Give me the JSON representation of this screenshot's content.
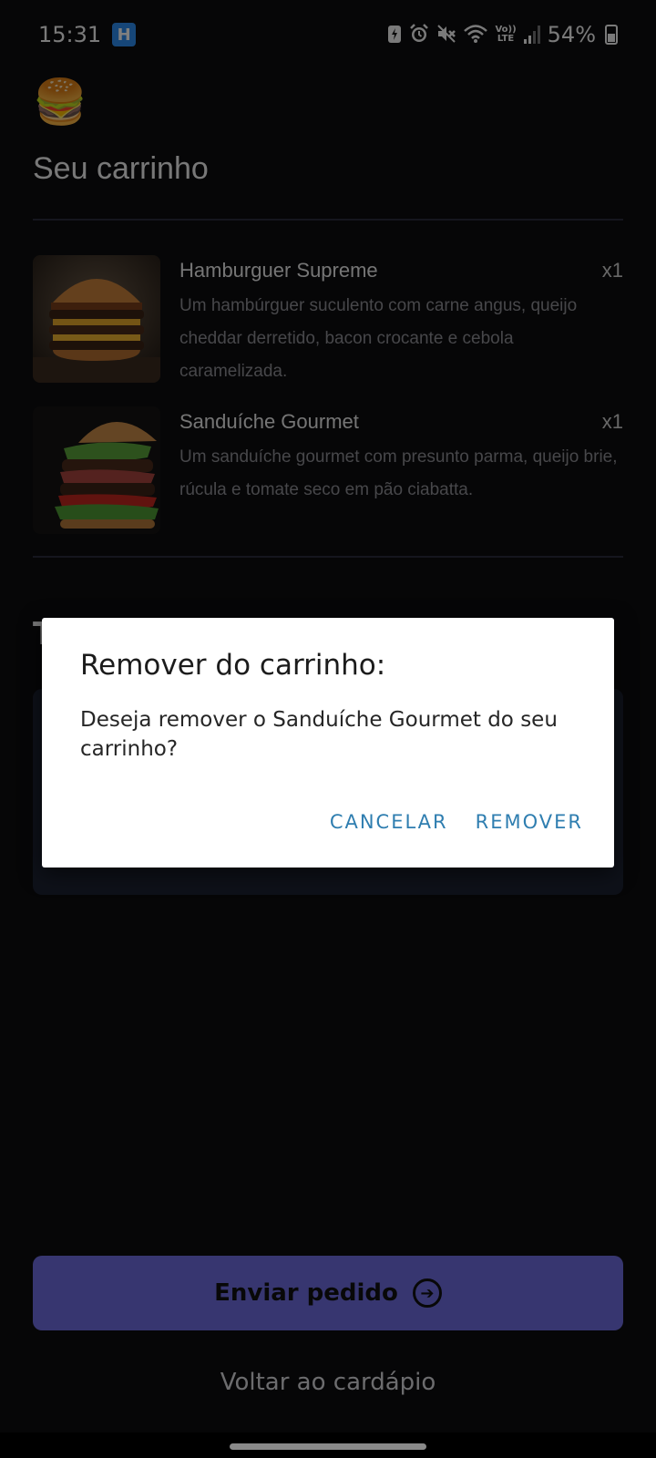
{
  "status_bar": {
    "time": "15:31",
    "app_badge_letter": "H",
    "battery_percent": "54%",
    "volte_top": "Vo))",
    "volte_bottom": "LTE",
    "icons": [
      "battery-saver-icon",
      "alarm-icon",
      "mute-icon",
      "wifi-icon",
      "volte-icon",
      "signal-icon",
      "battery-icon"
    ]
  },
  "header": {
    "logo_emoji": "🍔",
    "title": "Seu carrinho"
  },
  "cart": {
    "items": [
      {
        "name": "Hamburguer Supreme",
        "quantity": "x1",
        "description": "Um hambúrguer suculento com carne angus, queijo cheddar derretido, bacon crocante e cebola caramelizada."
      },
      {
        "name": "Sanduíche Gourmet",
        "quantity": "x1",
        "description": "Um sanduíche gourmet com presunto parma, queijo brie, rúcula e tomate seco em pão ciabatta."
      }
    ],
    "total_label_visible_fragment": "T"
  },
  "footer": {
    "send_label": "Enviar pedido",
    "back_label": "Voltar ao cardápio"
  },
  "dialog": {
    "title": "Remover do carrinho:",
    "message": "Deseja remover o Sanduíche Gourmet do seu carrinho?",
    "cancel_label": "CANCELAR",
    "confirm_label": "REMOVER"
  },
  "colors": {
    "background": "#0d0d0f",
    "accent_button": "#6f6de0",
    "dialog_action": "#2f7eb0",
    "card": "#1d2233"
  }
}
